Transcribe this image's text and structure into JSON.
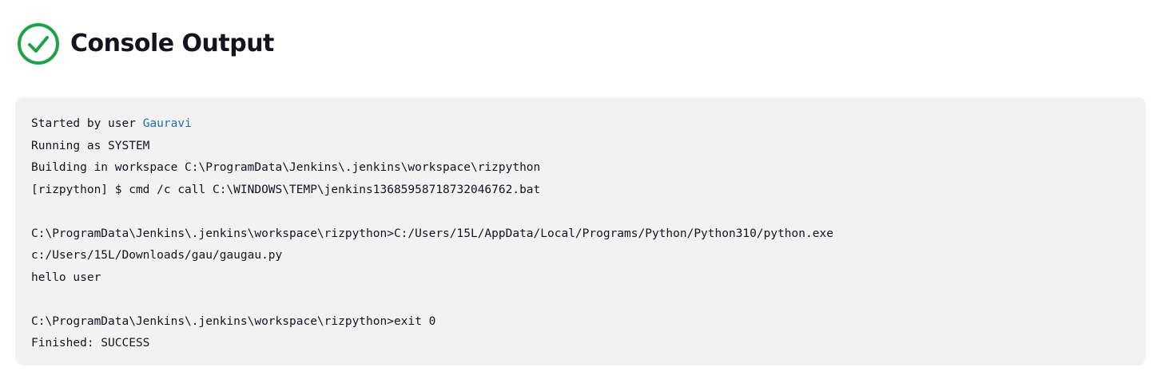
{
  "header": {
    "title": "Console Output",
    "status_icon": "check-circle-icon",
    "status_color": "#1ea446"
  },
  "console": {
    "started_prefix": "Started by user ",
    "user_name": "Gauravi",
    "link_color": "#1f6fb8",
    "lines": [
      "Running as SYSTEM",
      "Building in workspace C:\\ProgramData\\Jenkins\\.jenkins\\workspace\\rizpython",
      "[rizpython] $ cmd /c call C:\\WINDOWS\\TEMP\\jenkins13685958718732046762.bat",
      "",
      "C:\\ProgramData\\Jenkins\\.jenkins\\workspace\\rizpython>C:/Users/15L/AppData/Local/Programs/Python/Python310/python.exe",
      "c:/Users/15L/Downloads/gau/gaugau.py",
      "hello user",
      "",
      "C:\\ProgramData\\Jenkins\\.jenkins\\workspace\\rizpython>exit 0",
      "Finished: SUCCESS"
    ]
  }
}
